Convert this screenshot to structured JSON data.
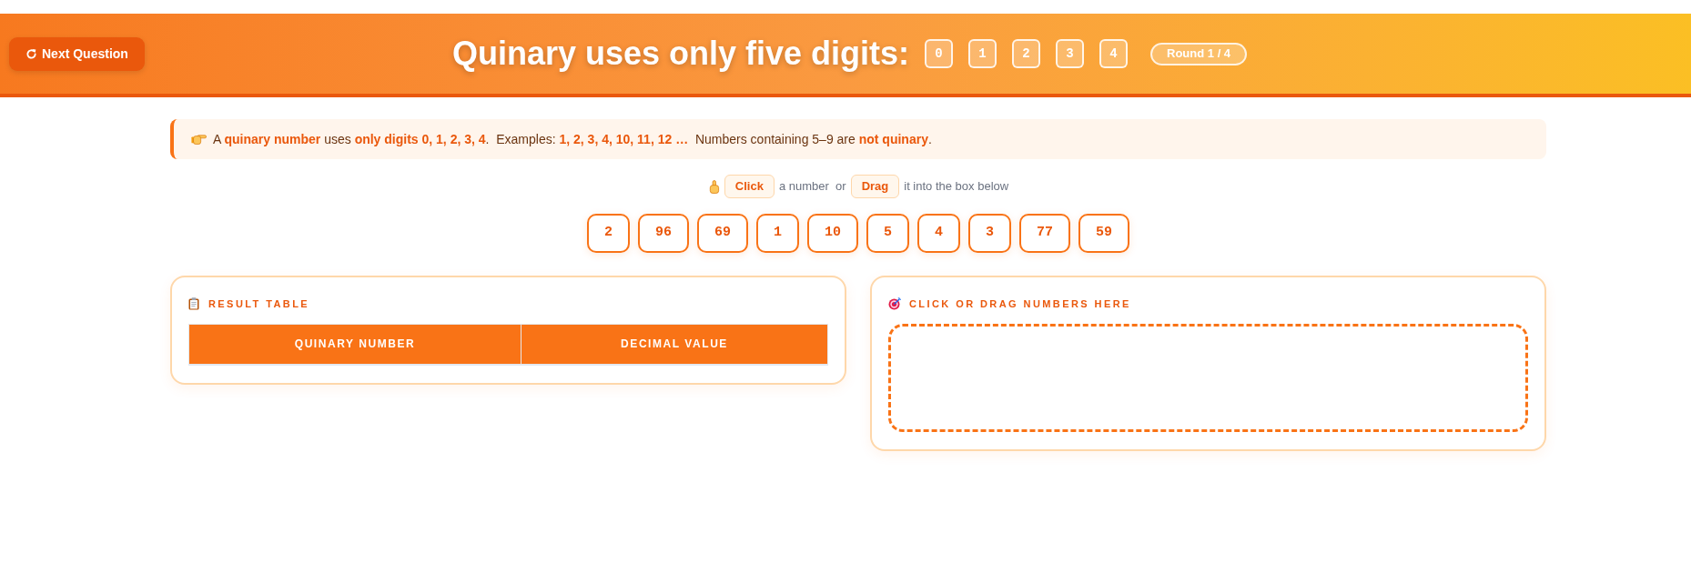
{
  "header": {
    "button": {
      "label": "Next Question"
    },
    "title": "Quinary uses only five digits:",
    "digits": [
      "0",
      "1",
      "2",
      "3",
      "4"
    ],
    "round": "Round 1 / 4"
  },
  "info": {
    "text": "A **quinary number** uses **only digits 0, 1, 2, 3, 4**.  Examples: **1, 2, 3, 4, 10, 11, 12 …**  Numbers containing 5–9 are **not quinary**."
  },
  "instruction": [
    {
      "kind": "keyword",
      "text": "Click"
    },
    {
      "kind": "plain",
      "text": "a number  or"
    },
    {
      "kind": "keyword",
      "text": "Drag"
    },
    {
      "kind": "plain",
      "text": "it into the box below"
    }
  ],
  "numbers": [
    "2",
    "96",
    "69",
    "1",
    "10",
    "5",
    "4",
    "3",
    "77",
    "59"
  ],
  "result_table": {
    "title": "RESULT TABLE",
    "columns": [
      "QUINARY NUMBER",
      "DECIMAL VALUE"
    ]
  },
  "drop_zone": {
    "title": "CLICK OR DRAG NUMBERS HERE"
  }
}
